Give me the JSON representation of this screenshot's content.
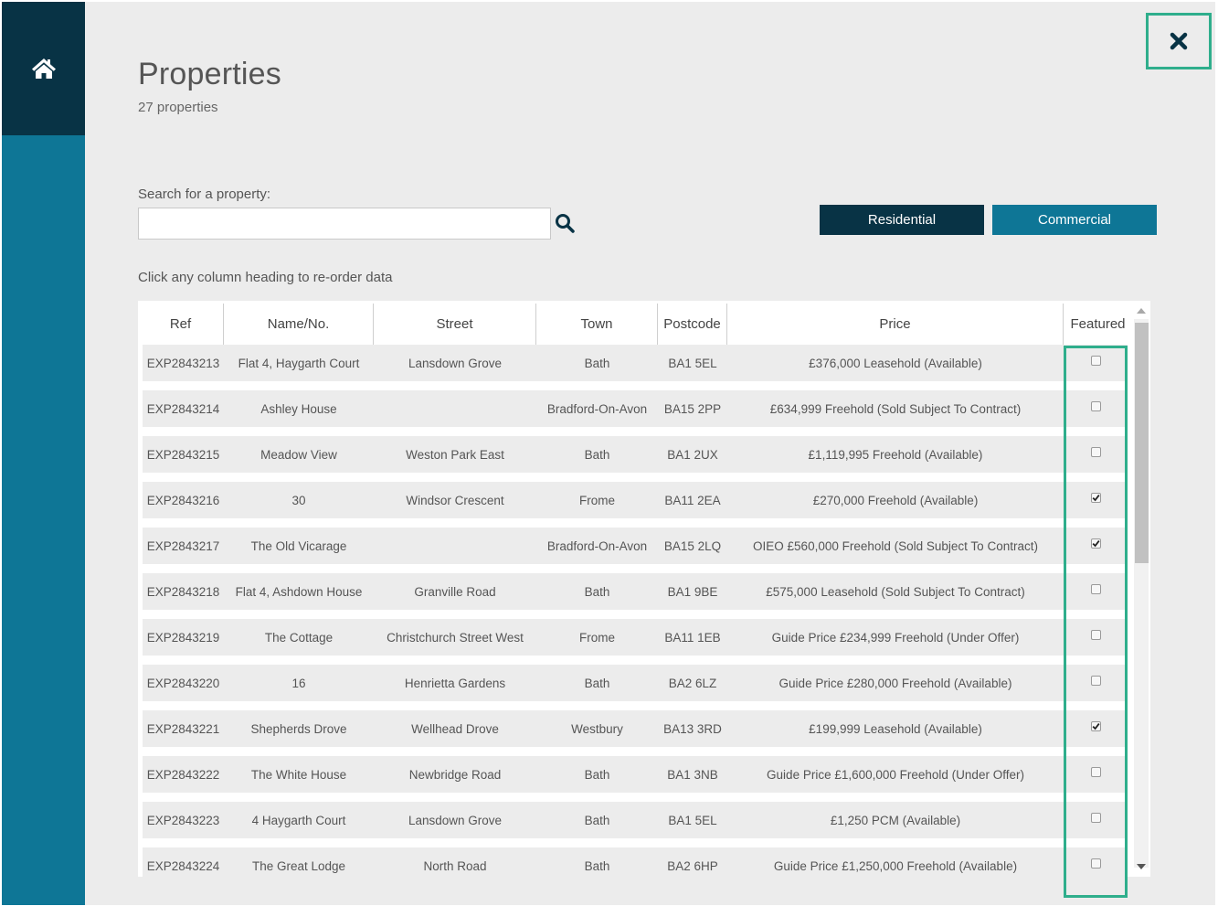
{
  "nav": {
    "home_icon": "home-icon"
  },
  "close_icon": "close-icon",
  "header": {
    "title": "Properties",
    "subtitle": "27 properties"
  },
  "search": {
    "label": "Search for a property:",
    "value": "",
    "placeholder": "",
    "icon": "search-icon"
  },
  "filters": {
    "residential_label": "Residential",
    "commercial_label": "Commercial"
  },
  "table_hint": "Click any column heading to re-order data",
  "table": {
    "headers": [
      "Ref",
      "Name/No.",
      "Street",
      "Town",
      "Postcode",
      "Price",
      "Featured"
    ],
    "rows": [
      {
        "ref": "EXP2843213",
        "name": "Flat 4, Haygarth Court",
        "street": "Lansdown Grove",
        "town": "Bath",
        "postcode": "BA1 5EL",
        "price": "£376,000 Leasehold (Available)",
        "featured": false
      },
      {
        "ref": "EXP2843214",
        "name": "Ashley House",
        "street": "",
        "town": "Bradford-On-Avon",
        "postcode": "BA15 2PP",
        "price": "£634,999 Freehold (Sold Subject To Contract)",
        "featured": false
      },
      {
        "ref": "EXP2843215",
        "name": "Meadow View",
        "street": "Weston Park East",
        "town": "Bath",
        "postcode": "BA1 2UX",
        "price": "£1,119,995 Freehold (Available)",
        "featured": false
      },
      {
        "ref": "EXP2843216",
        "name": "30",
        "street": "Windsor Crescent",
        "town": "Frome",
        "postcode": "BA11 2EA",
        "price": "£270,000 Freehold (Available)",
        "featured": true
      },
      {
        "ref": "EXP2843217",
        "name": "The Old Vicarage",
        "street": "",
        "town": "Bradford-On-Avon",
        "postcode": "BA15 2LQ",
        "price": "OIEO £560,000 Freehold (Sold Subject To Contract)",
        "featured": true
      },
      {
        "ref": "EXP2843218",
        "name": "Flat 4, Ashdown House",
        "street": "Granville Road",
        "town": "Bath",
        "postcode": "BA1 9BE",
        "price": "£575,000 Leasehold (Sold Subject To Contract)",
        "featured": false
      },
      {
        "ref": "EXP2843219",
        "name": "The Cottage",
        "street": "Christchurch Street West",
        "town": "Frome",
        "postcode": "BA11 1EB",
        "price": "Guide Price £234,999 Freehold (Under Offer)",
        "featured": false
      },
      {
        "ref": "EXP2843220",
        "name": "16",
        "street": "Henrietta Gardens",
        "town": "Bath",
        "postcode": "BA2 6LZ",
        "price": "Guide Price £280,000 Freehold (Available)",
        "featured": false
      },
      {
        "ref": "EXP2843221",
        "name": "Shepherds Drove",
        "street": "Wellhead Drove",
        "town": "Westbury",
        "postcode": "BA13 3RD",
        "price": "£199,999 Leasehold (Available)",
        "featured": true
      },
      {
        "ref": "EXP2843222",
        "name": "The White House",
        "street": "Newbridge Road",
        "town": "Bath",
        "postcode": "BA1 3NB",
        "price": "Guide Price £1,600,000 Freehold (Under Offer)",
        "featured": false
      },
      {
        "ref": "EXP2843223",
        "name": "4 Haygarth Court",
        "street": "Lansdown Grove",
        "town": "Bath",
        "postcode": "BA1 5EL",
        "price": "£1,250 PCM (Available)",
        "featured": false
      },
      {
        "ref": "EXP2843224",
        "name": "The Great Lodge",
        "street": "North Road",
        "town": "Bath",
        "postcode": "BA2 6HP",
        "price": "Guide Price £1,250,000 Freehold (Available)",
        "featured": false
      }
    ]
  },
  "colors": {
    "sidebar": "#0e7696",
    "sidebar_home": "#083345",
    "residential_button": "#083345",
    "commercial_button": "#0e7696",
    "highlight": "#2fae8c"
  }
}
